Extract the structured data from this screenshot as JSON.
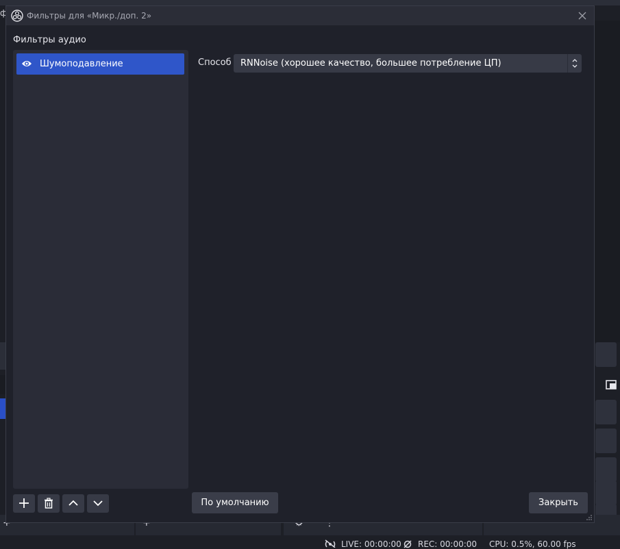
{
  "background": {
    "title_fragment": "ф",
    "status": {
      "live": "LIVE: 00:00:00",
      "rec": "REC: 00:00:00",
      "cpu": "CPU: 0.5%, 60.00 fps"
    }
  },
  "dialog": {
    "title": "Фильтры для «Микр./доп. 2»",
    "section_label": "Фильтры аудио",
    "filters": [
      {
        "label": "Шумоподавление",
        "visible": true,
        "selected": true
      }
    ],
    "property": {
      "label": "Способ",
      "value": "RNNoise (хорошее качество, большее потребление ЦП)"
    },
    "buttons": {
      "defaults": "По умолчанию",
      "close": "Закрыть"
    }
  },
  "colors": {
    "accent": "#2f56c9",
    "dialog_bg": "#1f212a",
    "panel_bg": "#2a2c37",
    "button_bg": "#3a3d49"
  }
}
